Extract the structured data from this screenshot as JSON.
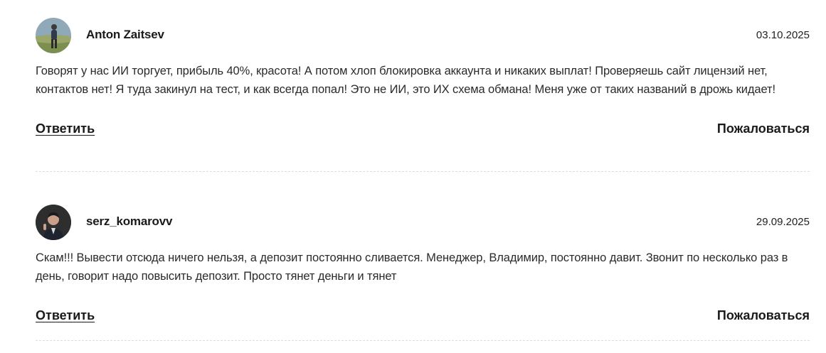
{
  "comments": [
    {
      "author": "Anton Zaitsev",
      "date": "03.10.2025",
      "text": "Говорят у нас ИИ торгует, прибыль 40%, красота! А потом хлоп блокировка аккаунта и никаких выплат! Проверяешь сайт лицензий нет, контактов нет! Я туда закинул на тест, и как всегда попал! Это не ИИ, это ИХ схема обмана! Меня уже от таких названий в дрожь кидает!",
      "reply_label": "Ответить",
      "report_label": "Пожаловаться"
    },
    {
      "author": "serz_komarovv",
      "date": "29.09.2025",
      "text": "Скам!!! Вывести отсюда ничего нельзя, а депозит постоянно сливается. Менеджер, Владимир, постоянно давит. Звонит по несколько раз в день, говорит надо повысить депозит. Просто тянет деньги и тянет",
      "reply_label": "Ответить",
      "report_label": "Пожаловаться"
    }
  ]
}
